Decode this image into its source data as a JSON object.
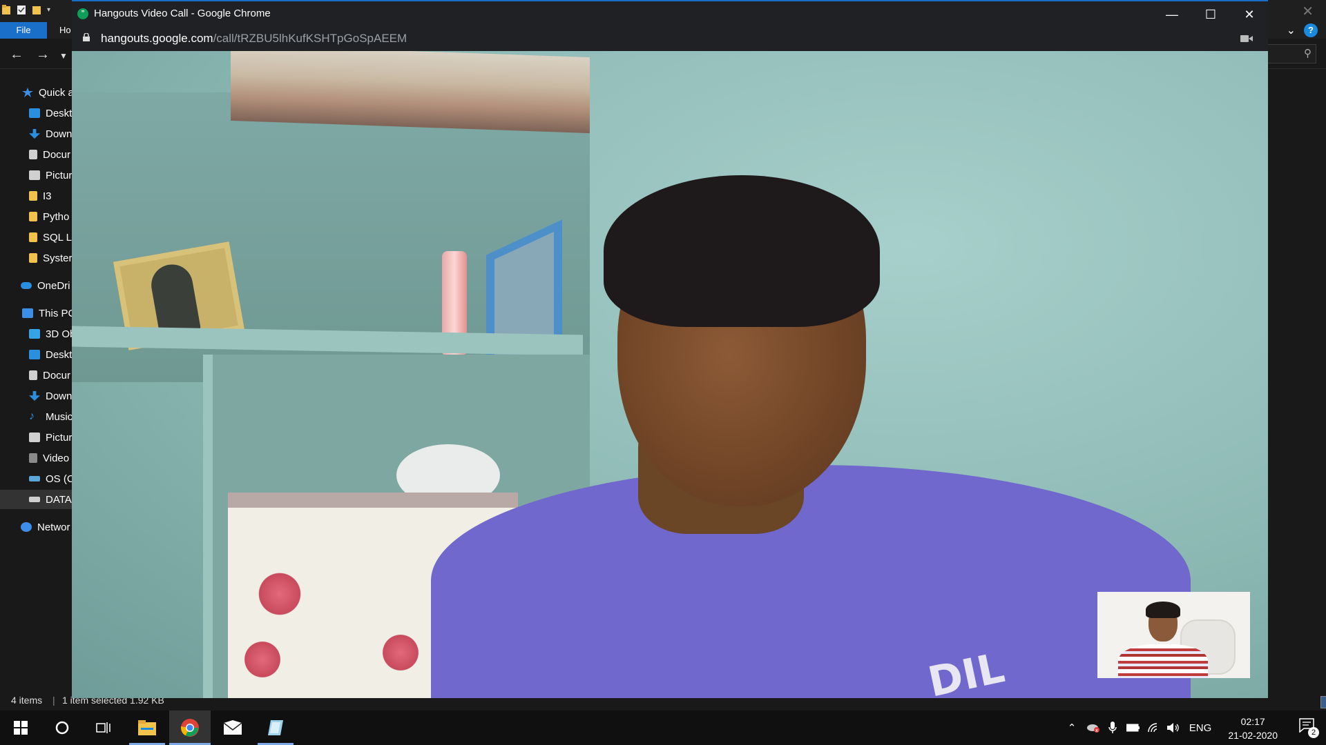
{
  "explorer": {
    "file_tab": "File",
    "home_tab": "Ho",
    "help": "?",
    "tree": [
      {
        "label": "Quick a",
        "icon": "star-icon",
        "color": "#3d8ee8"
      },
      {
        "label": "Deskt",
        "icon": "desktop-folder-icon",
        "color": "#2b8fe0"
      },
      {
        "label": "Down",
        "icon": "download-icon",
        "color": "#2b8fe0"
      },
      {
        "label": "Docur",
        "icon": "document-icon",
        "color": "#d0d0d0"
      },
      {
        "label": "Pictur",
        "icon": "pictures-icon",
        "color": "#d0d0d0"
      },
      {
        "label": "I3",
        "icon": "folder-icon",
        "color": "#f1c24c"
      },
      {
        "label": "Pytho",
        "icon": "folder-icon",
        "color": "#f1c24c"
      },
      {
        "label": "SQL L",
        "icon": "folder-icon",
        "color": "#f1c24c"
      },
      {
        "label": "Syster",
        "icon": "folder-icon",
        "color": "#f1c24c"
      },
      {
        "label": "OneDri",
        "icon": "cloud-icon",
        "color": "#2b8fe0"
      },
      {
        "label": "This PC",
        "icon": "computer-icon",
        "color": "#3d8ee8"
      },
      {
        "label": "3D Ob",
        "icon": "3d-objects-icon",
        "color": "#36a3e8"
      },
      {
        "label": "Deskt",
        "icon": "desktop-folder-icon",
        "color": "#2b8fe0"
      },
      {
        "label": "Docur",
        "icon": "document-icon",
        "color": "#d0d0d0"
      },
      {
        "label": "Down",
        "icon": "download-icon",
        "color": "#2b8fe0"
      },
      {
        "label": "Music",
        "icon": "music-icon",
        "color": "#2b8fe0"
      },
      {
        "label": "Pictur",
        "icon": "pictures-icon",
        "color": "#d0d0d0"
      },
      {
        "label": "Video",
        "icon": "video-icon",
        "color": "#8a8a8a"
      },
      {
        "label": "OS (C",
        "icon": "drive-icon",
        "color": "#5aa6d8"
      },
      {
        "label": "DATA",
        "icon": "drive-icon",
        "color": "#cfcfcf"
      },
      {
        "label": "Networ",
        "icon": "network-icon",
        "color": "#3d8ee8"
      }
    ],
    "status": {
      "items": "4 items",
      "selected": "1 item selected  1.92 KB"
    }
  },
  "chrome": {
    "title": "Hangouts Video Call - Google Chrome",
    "url_host": "hangouts.google.com",
    "url_path": "/call/tRZBU5lhKufKSHTpGoSpAEEM",
    "favicon_color": "#0f9d58"
  },
  "video": {
    "shirt_logo": "DIL"
  },
  "taskbar": {
    "apps": [
      {
        "name": "start",
        "icon": "windows-logo-icon"
      },
      {
        "name": "search",
        "icon": "cortana-circle-icon"
      },
      {
        "name": "task-view",
        "icon": "task-view-icon"
      },
      {
        "name": "file-explorer",
        "icon": "file-explorer-icon"
      },
      {
        "name": "chrome",
        "icon": "chrome-icon"
      },
      {
        "name": "mail",
        "icon": "mail-icon"
      },
      {
        "name": "app",
        "icon": "app-icon"
      }
    ],
    "language": "ENG",
    "time": "02:17",
    "date": "21-02-2020",
    "notifications": "2"
  }
}
